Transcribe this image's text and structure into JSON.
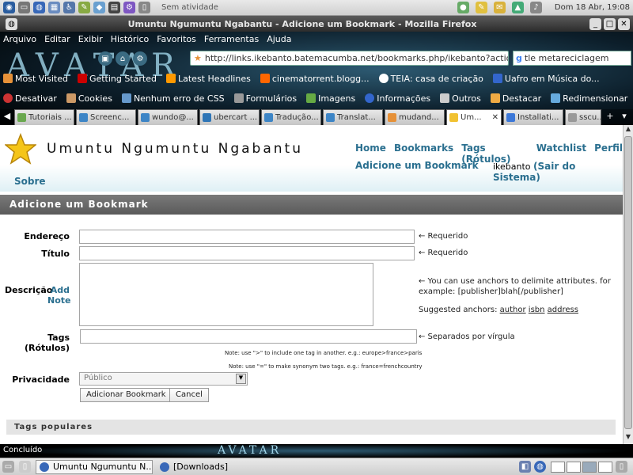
{
  "system_panel": {
    "status": "Sem atividade",
    "clock": "Dom 18 Abr, 19:08"
  },
  "window": {
    "title": "Umuntu Ngumuntu Ngabantu - Adicione um Bookmark - Mozilla Firefox"
  },
  "menubar": [
    "Arquivo",
    "Editar",
    "Exibir",
    "Histórico",
    "Favoritos",
    "Ferramentas",
    "Ajuda"
  ],
  "chrome": {
    "url": "http://links.ikebanto.batemacumba.net/bookmarks.php/ikebanto?action=add",
    "search_value": "tle metareciclagem",
    "theme_logo": "AVATAR"
  },
  "bookmarks_toolbar": [
    "Most Visited",
    "Getting Started",
    "Latest Headlines",
    "cinematorrent.blogg...",
    "TEIA: casa de criação",
    "Uafro em Música do..."
  ],
  "webdev_toolbar": [
    "Desativar",
    "Cookies",
    "Nenhum erro de CSS",
    "Formulários",
    "Imagens",
    "Informações",
    "Outros",
    "Destacar",
    "Redimensionar"
  ],
  "tabs": [
    {
      "label": "Tutoriais ...",
      "color": "#6aa84f"
    },
    {
      "label": "Screenc...",
      "color": "#3d85c6"
    },
    {
      "label": "wundo@...",
      "color": "#3d85c6"
    },
    {
      "label": "ubercart ...",
      "color": "#2e75b6"
    },
    {
      "label": "Tradução...",
      "color": "#3d85c6"
    },
    {
      "label": "Translat...",
      "color": "#3d85c6"
    },
    {
      "label": "mudand...",
      "color": "#e69138"
    },
    {
      "label": "Um...",
      "color": "#f1c232",
      "active": true
    },
    {
      "label": "Installati...",
      "color": "#3c78d8"
    },
    {
      "label": "sscu...",
      "color": "#999999"
    }
  ],
  "site": {
    "title": "Umuntu Ngumuntu Ngabantu",
    "nav": [
      "Home",
      "Bookmarks",
      "Tags (Rótulos)",
      "Watchlist",
      "Perfil"
    ],
    "add_bookmark": "Adicione um Bookmark",
    "username": "ikebanto",
    "logout": "(Sair do Sistema)",
    "about": "Sobre"
  },
  "form": {
    "section_title": "Adicione um Bookmark",
    "address_label": "Endereço",
    "title_label": "Título",
    "description_label": "Descrição",
    "add_note": "Add Note",
    "tags_label": "Tags (Rótulos)",
    "privacy_label": "Privacidade",
    "required_hint": "← Requerido",
    "required_hint2": "← Requerido",
    "anchors_hint": "← You can use anchors to delimite attributes. for example: [publisher]blah[/publisher]",
    "suggested_label": "Suggested anchors:",
    "suggested_anchors": [
      "author",
      "isbn",
      "address"
    ],
    "tags_hint": "← Separados por vírgula",
    "note1": "Note: use \">\" to include one tag in another. e.g.: europe>france>paris",
    "note2": "Note: use \"=\" to make synonym two tags. e.g.: france=frenchcountry",
    "privacy_value": "Público",
    "submit_label": "Adicionar Bookmark",
    "cancel_label": "Cancel",
    "popular_tags": "Tags populares"
  },
  "statusbar": {
    "text": "Concluído",
    "logo": "AVATAR"
  },
  "taskbar": {
    "items": [
      "Umuntu Ngumuntu N...",
      "[Downloads]"
    ]
  }
}
